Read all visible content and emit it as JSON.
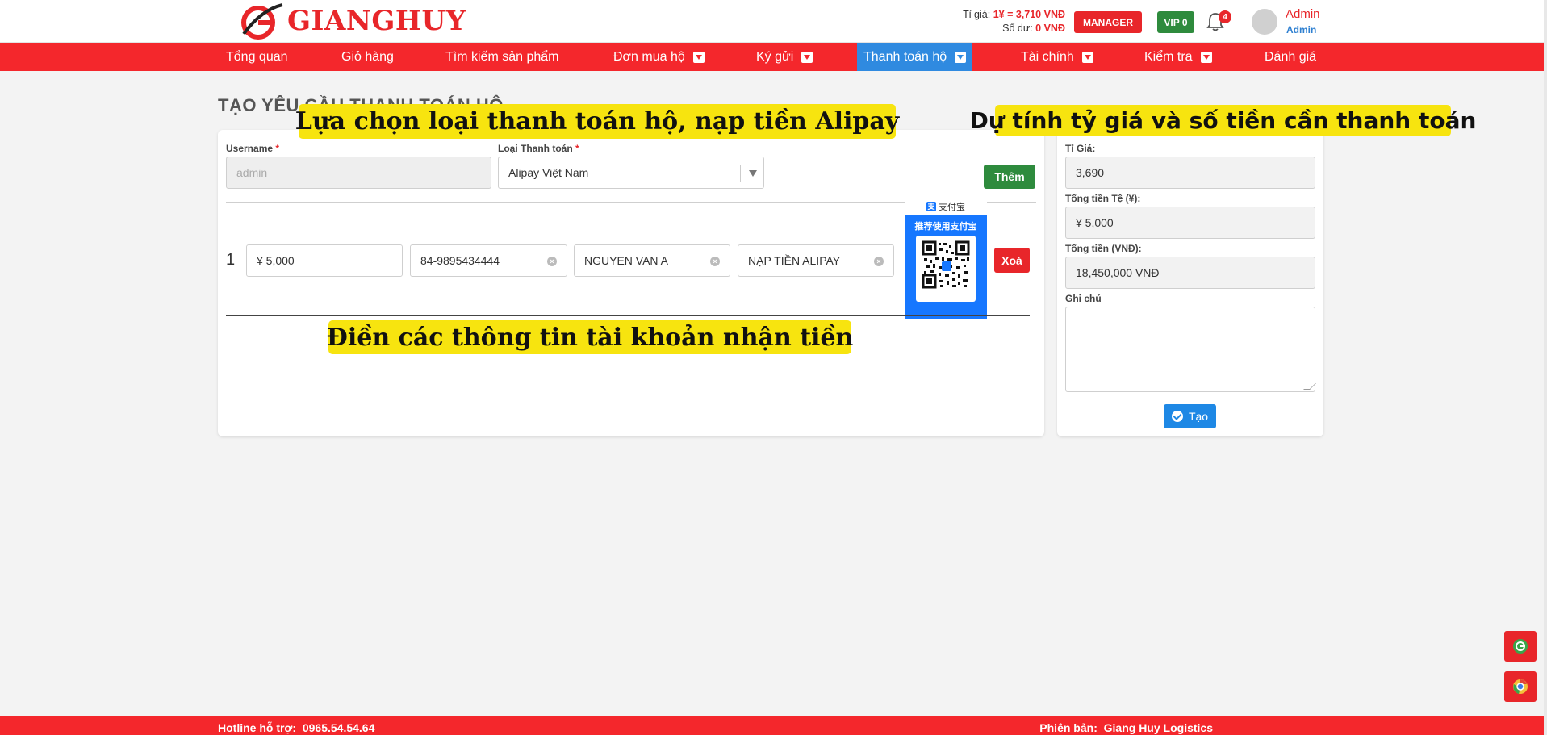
{
  "header": {
    "logo_text": "GIANGHUY",
    "rate_label": "Tỉ giá:",
    "rate_value": "1¥ = 3,710 VNĐ",
    "balance_label": "Số dư:",
    "balance_value": "0 VNĐ",
    "manager_label": "MANAGER",
    "vip_label": "VIP 0",
    "notification_count": "4",
    "user_name": "Admin",
    "user_role": "Admin"
  },
  "nav": {
    "items": [
      {
        "label": "Tổng quan"
      },
      {
        "label": "Giỏ hàng"
      },
      {
        "label": "Tìm kiếm sản phẩm"
      },
      {
        "label": "Đơn mua hộ"
      },
      {
        "label": "Ký gửi"
      },
      {
        "label": "Thanh toán hộ"
      },
      {
        "label": "Tài chính"
      },
      {
        "label": "Kiểm tra"
      },
      {
        "label": "Đánh giá"
      }
    ],
    "active": "Thanh toán hộ"
  },
  "page": {
    "title": "TẠO YÊU CẦU THANH TOÁN HỘ"
  },
  "form": {
    "username_label": "Username",
    "username_placeholder": "admin",
    "payment_type_label": "Loại Thanh toán",
    "payment_type_value": "Alipay Việt Nam",
    "add_button": "Thêm",
    "rows": [
      {
        "index": "1",
        "amount": "¥ 5,000",
        "account": "84-9895434444",
        "account_name": "NGUYEN VAN A",
        "note": "NẠP TIỀN ALIPAY",
        "delete_button": "Xoá"
      }
    ],
    "alipay": {
      "brand": "支付宝",
      "title": "推荐使用支付宝"
    }
  },
  "summary": {
    "rate_label": "Tỉ Giá:",
    "rate_value": "3,690",
    "total_cny_label": "Tổng tiền Tệ (¥):",
    "total_cny_value": "¥ 5,000",
    "total_vnd_label": "Tổng tiền (VNĐ):",
    "total_vnd_value": "18,450,000 VNĐ",
    "note_label": "Ghi chú",
    "create_button": "Tạo"
  },
  "annotations": {
    "top_left": "Lựa chọn loại thanh toán hộ, nạp tiền Alipay",
    "top_right": "Dự tính tỷ giá và số tiền cần thanh toán",
    "middle": "Điền các thông tin tài khoản nhận tiền"
  },
  "footer": {
    "hotline_label": "Hotline hỗ trợ:",
    "hotline_value": "0965.54.54.64",
    "version_label": "Phiên bản:",
    "version_value": "Giang Huy Logistics"
  },
  "colors": {
    "brand_red": "#f4272c",
    "active_blue": "#2f8ae0",
    "success_green": "#2e8b3d",
    "annotation_yellow": "#f7e40f",
    "alipay_blue": "#1677ff"
  },
  "icons": [
    "logo-icon",
    "bell-icon",
    "caret-down-icon",
    "clear-icon",
    "check-circle-icon",
    "alipay-icon",
    "qr-code-icon",
    "chrome-icon"
  ]
}
